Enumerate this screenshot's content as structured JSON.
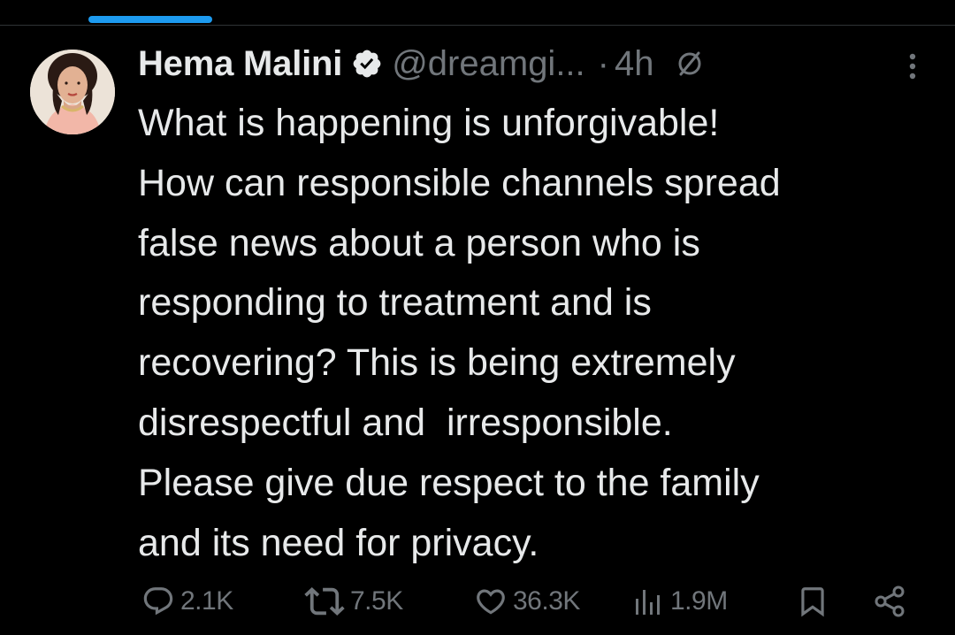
{
  "colors": {
    "background": "#000000",
    "text": "#e7e9ea",
    "muted": "#71767b",
    "accent": "#1d9bf0"
  },
  "tweet": {
    "author_name": "Hema Malini",
    "handle": "@dreamgi...",
    "separator": "·",
    "time": "4h",
    "icons": {
      "verified": "verified-badge-icon",
      "no_reply": "circle-slash-icon",
      "more": "more-vertical-icon"
    },
    "text_lines": [
      "What is happening is unforgivable!",
      "How can responsible channels spread",
      "false news about a person who is",
      "responding to treatment and is",
      "recovering? This is being extremely",
      "disrespectful and  irresponsible.",
      "Please give due respect to the family",
      "and its need for privacy."
    ],
    "actions": {
      "replies": "2.1K",
      "retweets": "7.5K",
      "likes": "36.3K",
      "views": "1.9M"
    }
  }
}
